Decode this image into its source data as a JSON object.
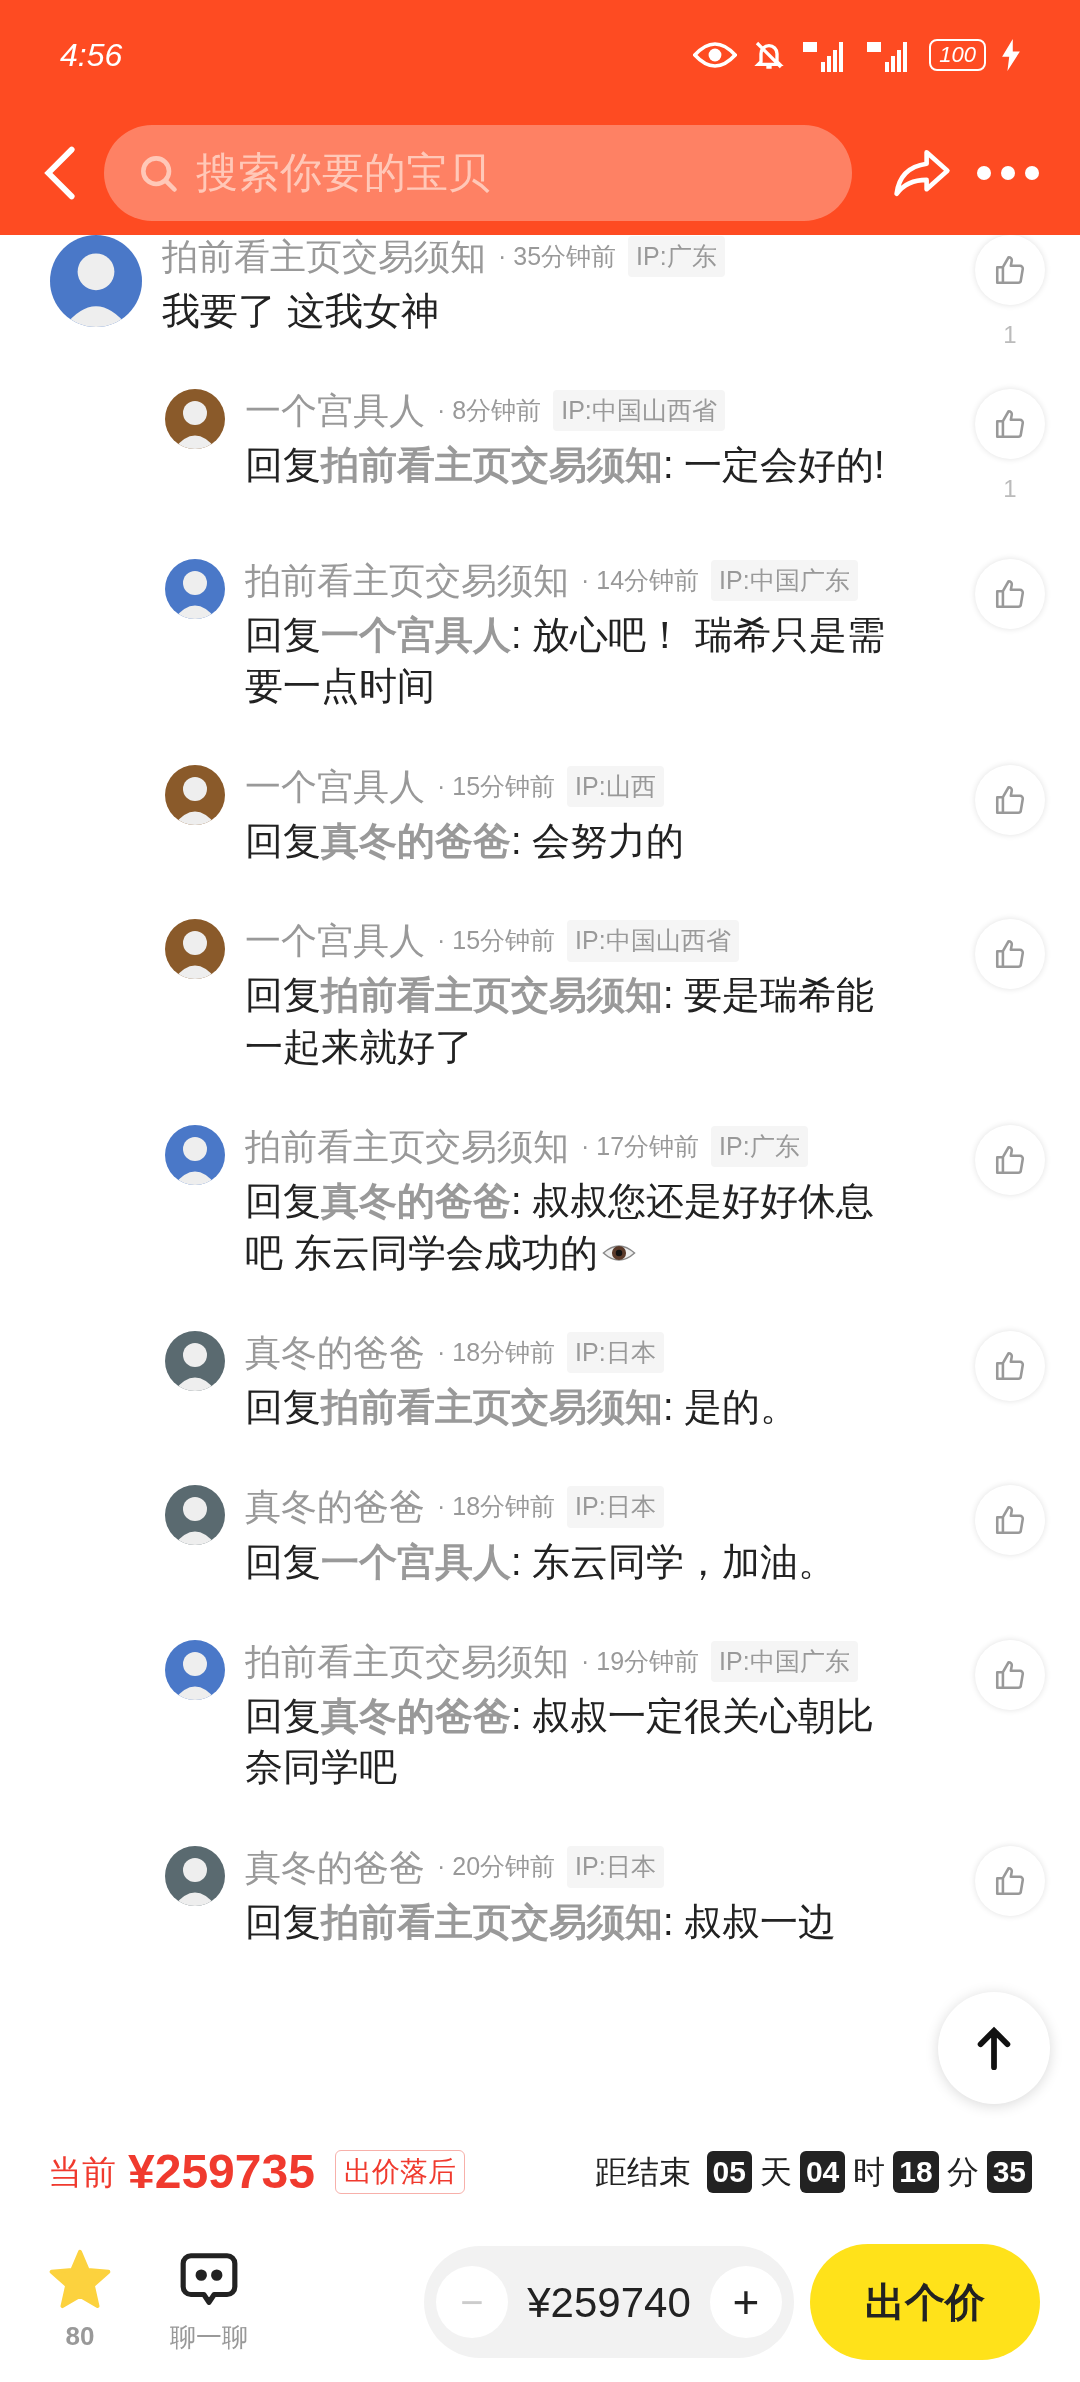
{
  "status_bar": {
    "time": "4:56",
    "battery": "100"
  },
  "header": {
    "search_placeholder": "搜索你要的宝贝"
  },
  "comments": [
    {
      "author": "拍前看主页交易须知",
      "time": "· 35分钟前",
      "ip": "IP:广东",
      "color": "#4a78c8",
      "text": "我要了 这我女神",
      "likes": "1",
      "replies": [
        {
          "author": "一个宫具人",
          "time": "· 8分钟前",
          "ip": "IP:中国山西省",
          "color": "#8a5a2a",
          "text": "回复**拍前看主页交易须知**: 一定会好的!",
          "likes": "1"
        },
        {
          "author": "拍前看主页交易须知",
          "time": "· 14分钟前",
          "ip": "IP:中国广东",
          "color": "#4a78c8",
          "text": "回复**一个宫具人**: 放心吧！ 瑞希只是需要一点时间"
        },
        {
          "author": "一个宫具人",
          "time": "· 15分钟前",
          "ip": "IP:山西",
          "color": "#8a5a2a",
          "text": "回复**真冬的爸爸**: 会努力的"
        },
        {
          "author": "一个宫具人",
          "time": "· 15分钟前",
          "ip": "IP:中国山西省",
          "color": "#8a5a2a",
          "text": "回复**拍前看主页交易须知**: 要是瑞希能一起来就好了"
        },
        {
          "author": "拍前看主页交易须知",
          "time": "· 17分钟前",
          "ip": "IP:广东",
          "color": "#4a78c8",
          "text": "回复**真冬的爸爸**: 叔叔您还是好好休息吧 东云同学会成功的",
          "eye_emoji": true
        },
        {
          "author": "真冬的爸爸",
          "time": "· 18分钟前",
          "ip": "IP:日本",
          "color": "#5a6a70",
          "text": "回复**拍前看主页交易须知**: 是的。"
        },
        {
          "author": "真冬的爸爸",
          "time": "· 18分钟前",
          "ip": "IP:日本",
          "color": "#5a6a70",
          "text": "回复**一个宫具人**: 东云同学，加油。"
        },
        {
          "author": "拍前看主页交易须知",
          "time": "· 19分钟前",
          "ip": "IP:中国广东",
          "color": "#4a78c8",
          "text": "回复**真冬的爸爸**: 叔叔一定很关心朝比奈同学吧"
        },
        {
          "author": "真冬的爸爸",
          "time": "· 20分钟前",
          "ip": "IP:日本",
          "color": "#5a6a70",
          "text": "回复**拍前看主页交易须知**: 叔叔一边"
        }
      ]
    }
  ],
  "price": {
    "label": "当前",
    "amount": "¥259735",
    "status": "出价落后"
  },
  "countdown": {
    "label": "距结束",
    "parts": [
      {
        "value": "05",
        "unit": "天"
      },
      {
        "value": "04",
        "unit": "时"
      },
      {
        "value": "18",
        "unit": "分"
      },
      {
        "value": "35"
      }
    ]
  },
  "bottom_bar": {
    "favorites": "80",
    "chat": "聊一聊",
    "minus": "−",
    "bid": "¥259740",
    "plus": "+",
    "submit": "出个价"
  }
}
